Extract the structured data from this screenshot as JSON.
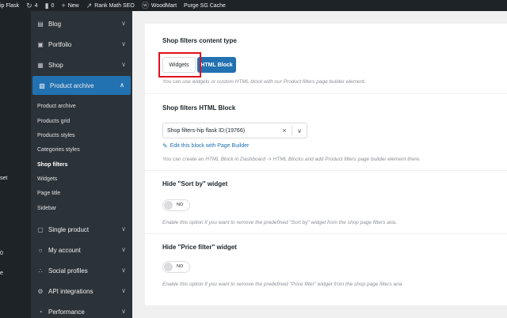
{
  "admin_bar": {
    "site_fragment": "ip Flask",
    "updates_count": "4",
    "comments_count": "0",
    "new_label": "New",
    "rank_math_label": "Rank Math SEO",
    "woodmart_label": "WoodMart",
    "purge_label": "Purge SG Cache",
    "icons": [
      "refresh-icon",
      "comment-icon",
      "plus-icon",
      "rank-math-icon",
      "woodmart-icon"
    ]
  },
  "wp_menu": {
    "fragment_set": "set",
    "fragment_0": "0",
    "fragment_e": "e"
  },
  "sidebar": {
    "items": [
      {
        "label": "Blog",
        "icon": "blog-icon"
      },
      {
        "label": "Portfolio",
        "icon": "portfolio-icon"
      },
      {
        "label": "Shop",
        "icon": "cart-icon"
      },
      {
        "label": "Product archive",
        "icon": "archive-icon"
      },
      {
        "label": "Single product",
        "icon": "product-icon"
      },
      {
        "label": "My account",
        "icon": "user-icon"
      },
      {
        "label": "Social profiles",
        "icon": "share-icon"
      },
      {
        "label": "API integrations",
        "icon": "api-icon"
      },
      {
        "label": "Performance",
        "icon": "gauge-icon"
      }
    ],
    "subitems": [
      "Product archive",
      "Products grid",
      "Products styles",
      "Categories styles",
      "Shop filters",
      "Widgets",
      "Page title",
      "Sidebar"
    ],
    "active_item": "Product archive",
    "current_subitem": "Shop filters"
  },
  "content_type": {
    "title": "Shop filters content type",
    "options": [
      "Widgets",
      "HTML Block"
    ],
    "selected": "HTML Block",
    "description": "You can use widgets or custom HTML block with our Product filters page builder element."
  },
  "html_block": {
    "title": "Shop filters HTML Block",
    "value": "Shop filters-hip flask ID:(19766)",
    "edit_link": "Edit this block with Page Builder",
    "description": "You can create an HTML Block in Dashboard -> HTML Blocks and add Product filters page builder element there."
  },
  "hide_sort": {
    "title": "Hide \"Sort by\" widget",
    "toggle_label": "NO",
    "description": "Enable this option if you want to remove the predefined \"Sort by\" widget from the shop page filters aria."
  },
  "hide_price": {
    "title": "Hide \"Price filter\" widget",
    "toggle_label": "NO",
    "description": "Enable this option if you want to remove the predefined \"Price filter\" widget from the shop page filters aria."
  },
  "colors": {
    "accent": "#2271b1",
    "highlight": "#e0101e",
    "admin_bar": "#1d2327",
    "sidebar": "#2c3338"
  }
}
